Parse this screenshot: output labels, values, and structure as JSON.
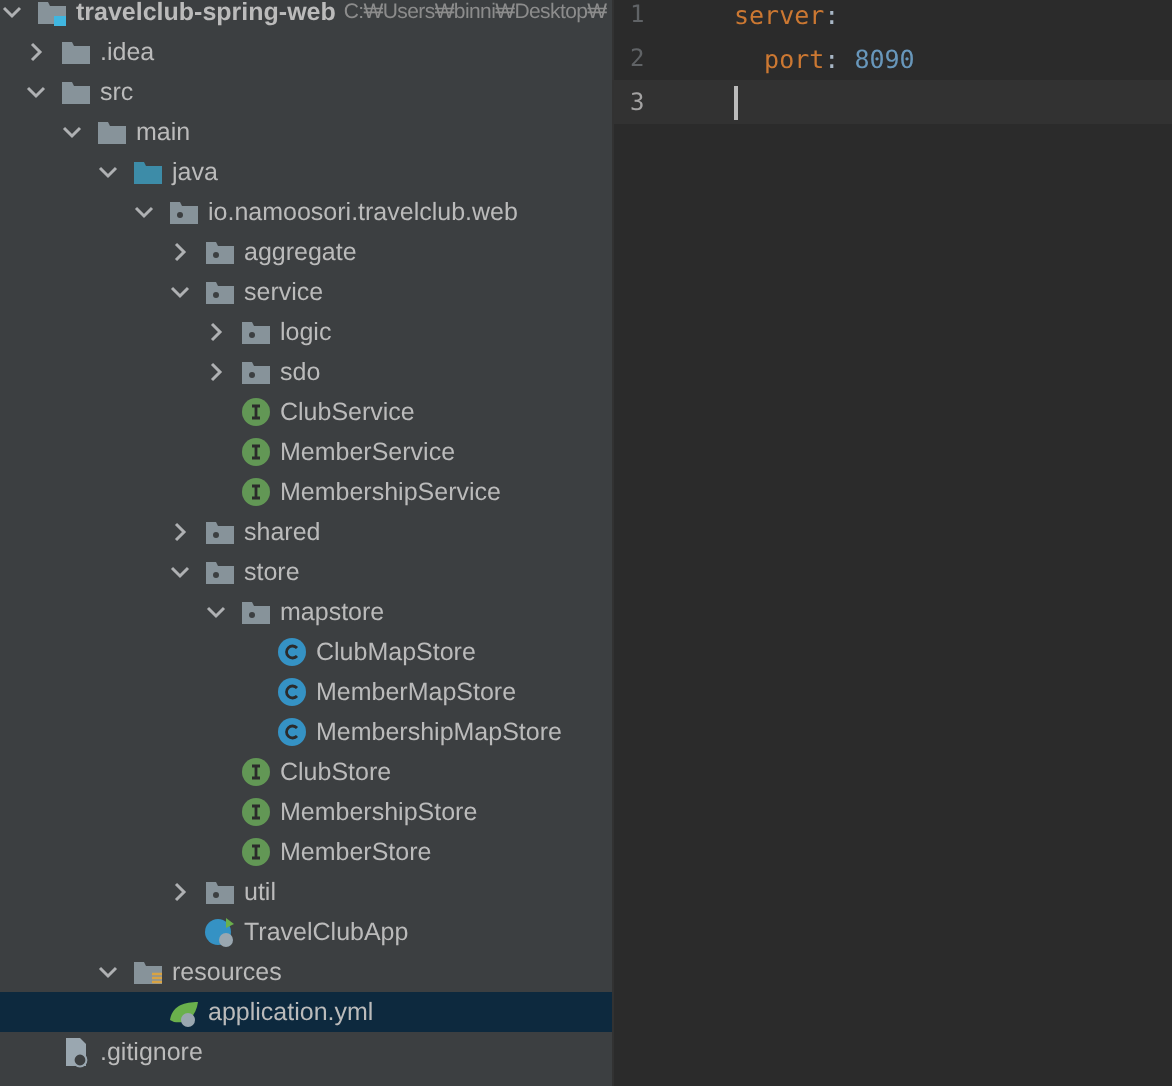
{
  "project_tree": {
    "root": {
      "name": "travelclub-spring-web",
      "path": "C:₩Users₩binni₩Desktop₩",
      "expanded": true
    },
    "items": [
      {
        "name": ".idea",
        "kind": "folder",
        "expanded": false,
        "selected": false
      },
      {
        "name": "src",
        "kind": "folder",
        "expanded": true,
        "selected": false,
        "children": [
          {
            "name": "main",
            "kind": "folder",
            "expanded": true,
            "selected": false,
            "children": [
              {
                "name": "java",
                "kind": "source-folder",
                "expanded": true,
                "selected": false,
                "children": [
                  {
                    "name": "io.namoosori.travelclub.web",
                    "kind": "package",
                    "expanded": true,
                    "selected": false,
                    "children": [
                      {
                        "name": "aggregate",
                        "kind": "package",
                        "expanded": false,
                        "selected": false
                      },
                      {
                        "name": "service",
                        "kind": "package",
                        "expanded": true,
                        "selected": false,
                        "children": [
                          {
                            "name": "logic",
                            "kind": "package",
                            "expanded": false,
                            "selected": false
                          },
                          {
                            "name": "sdo",
                            "kind": "package",
                            "expanded": false,
                            "selected": false
                          },
                          {
                            "name": "ClubService",
                            "kind": "interface",
                            "selected": false
                          },
                          {
                            "name": "MemberService",
                            "kind": "interface",
                            "selected": false
                          },
                          {
                            "name": "MembershipService",
                            "kind": "interface",
                            "selected": false
                          }
                        ]
                      },
                      {
                        "name": "shared",
                        "kind": "package",
                        "expanded": false,
                        "selected": false
                      },
                      {
                        "name": "store",
                        "kind": "package",
                        "expanded": true,
                        "selected": false,
                        "children": [
                          {
                            "name": "mapstore",
                            "kind": "package",
                            "expanded": true,
                            "selected": false,
                            "children": [
                              {
                                "name": "ClubMapStore",
                                "kind": "class",
                                "selected": false
                              },
                              {
                                "name": "MemberMapStore",
                                "kind": "class",
                                "selected": false
                              },
                              {
                                "name": "MembershipMapStore",
                                "kind": "class",
                                "selected": false
                              }
                            ]
                          },
                          {
                            "name": "ClubStore",
                            "kind": "interface",
                            "selected": false
                          },
                          {
                            "name": "MembershipStore",
                            "kind": "interface",
                            "selected": false
                          },
                          {
                            "name": "MemberStore",
                            "kind": "interface",
                            "selected": false
                          }
                        ]
                      },
                      {
                        "name": "util",
                        "kind": "package",
                        "expanded": false,
                        "selected": false
                      },
                      {
                        "name": "TravelClubApp",
                        "kind": "spring-app",
                        "selected": false
                      }
                    ]
                  }
                ]
              },
              {
                "name": "resources",
                "kind": "resources",
                "expanded": true,
                "selected": false,
                "children": [
                  {
                    "name": "application.yml",
                    "kind": "yml",
                    "selected": true
                  }
                ]
              }
            ]
          }
        ]
      },
      {
        "name": ".gitignore",
        "kind": "gitignore",
        "selected": false
      }
    ]
  },
  "editor": {
    "lines": [
      {
        "number": "1",
        "current": false,
        "tokens": [
          {
            "kind": "key",
            "text": "server"
          },
          {
            "kind": "punct",
            "text": ":"
          }
        ]
      },
      {
        "number": "2",
        "current": false,
        "tokens": [
          {
            "kind": "key",
            "text": "  port"
          },
          {
            "kind": "punct",
            "text": ": "
          },
          {
            "kind": "number",
            "text": "8090"
          }
        ]
      },
      {
        "number": "3",
        "current": true
      }
    ]
  }
}
